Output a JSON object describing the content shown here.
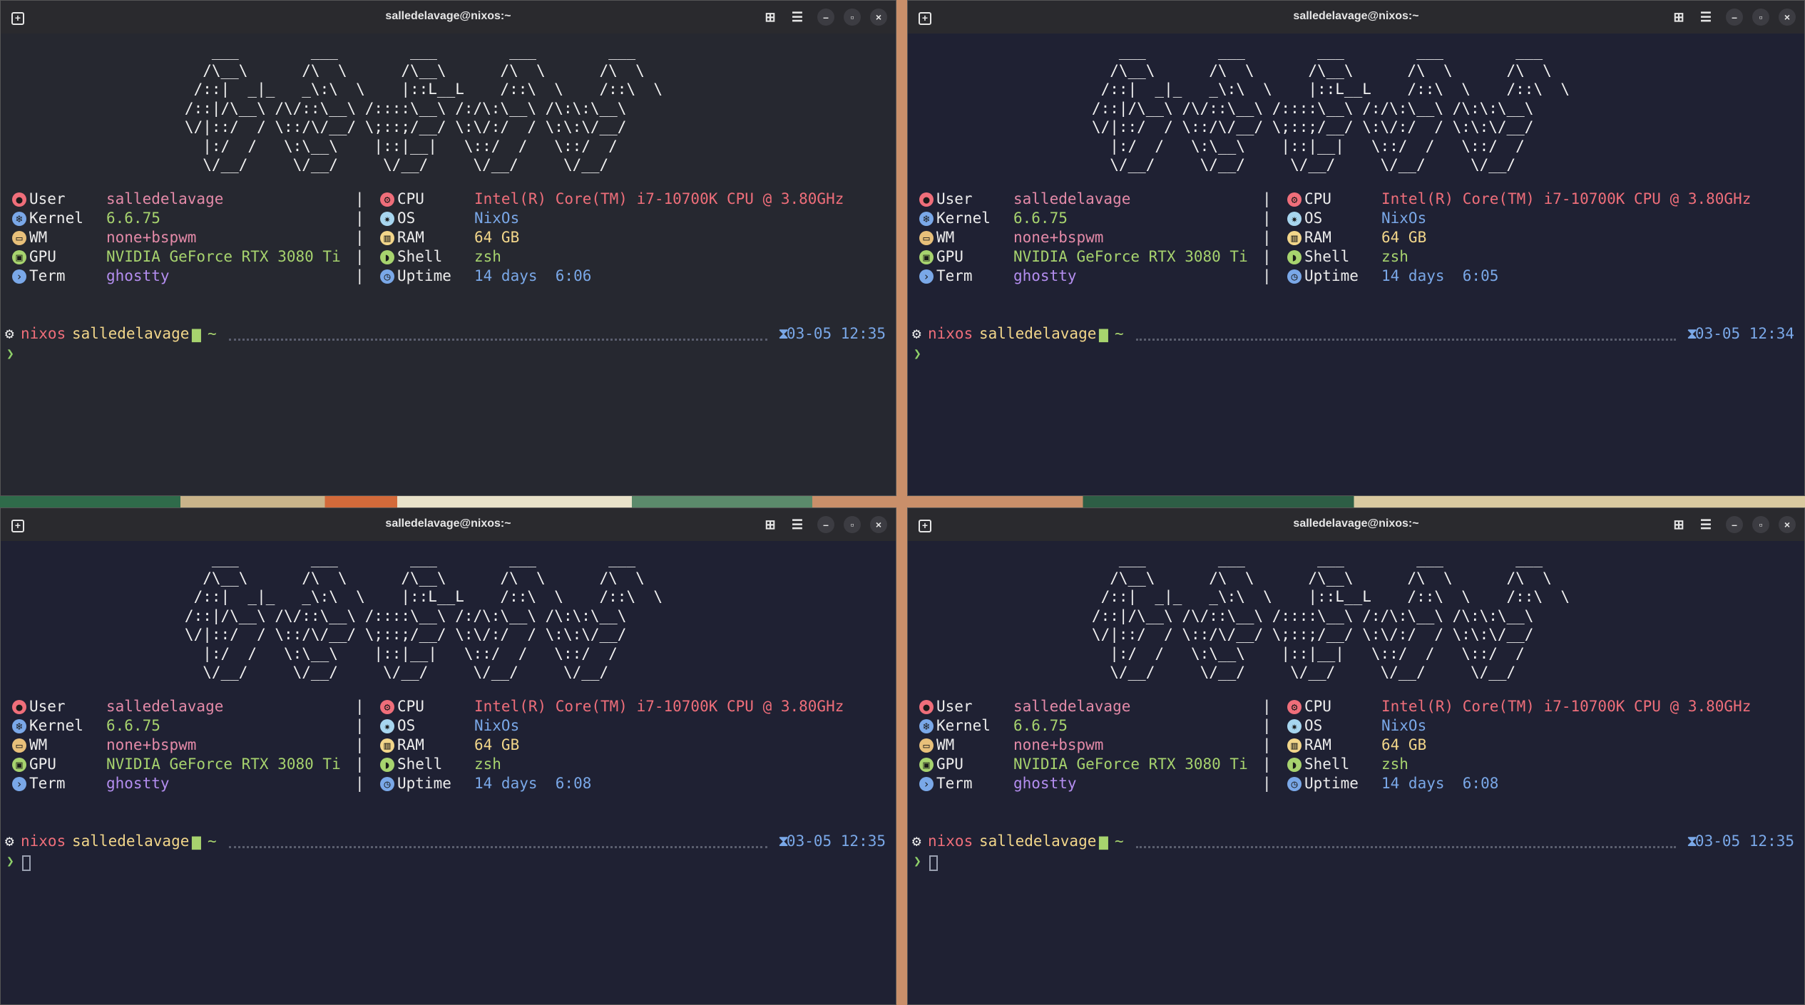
{
  "window_title": "salledelavage@nixos:~",
  "ascii_logo": "      ___        ___        ___        ___        ___     \n     /\\__\\      /\\  \\      /\\__\\      /\\  \\      /\\  \\    \n    /::|  _|_   _\\:\\  \\    |::L__L    /::\\  \\    /::\\  \\   \n   /::|/\\__\\ /\\/::\\__\\ /::::\\__\\ /:/\\:\\__\\ /\\:\\:\\__\\  \n   \\/|::/  / \\::/\\/__/ \\;::;/__/ \\:\\/:/  / \\:\\:\\/__/  \n     |:/  /   \\:\\__\\    |::|__|   \\::/  /   \\::/  /   \n     \\/__/     \\/__/     \\/__/     \\/__/     \\/__/    ",
  "separator": "|",
  "info_left": [
    {
      "icon": "user-circle-icon",
      "label": "User",
      "value": "salledelavage"
    },
    {
      "icon": "nix-flake-icon",
      "label": "Kernel",
      "value": "6.6.75"
    },
    {
      "icon": "window-manager-icon",
      "label": "WM",
      "value": "none+bspwm"
    },
    {
      "icon": "gpu-card-icon",
      "label": "GPU",
      "value": "NVIDIA GeForce RTX 3080 Ti"
    },
    {
      "icon": "terminal-prompt-icon",
      "label": "Term",
      "value": "ghostty"
    }
  ],
  "info_right": [
    {
      "icon": "cpu-chip-icon",
      "label": "CPU",
      "value": "Intel(R) Core(TM) i7-10700K CPU @ 3.80GHz"
    },
    {
      "icon": "gear-snowflake-icon",
      "label": "OS",
      "value": "NixOs"
    },
    {
      "icon": "ram-stick-icon",
      "label": "RAM",
      "value": "64 GB"
    },
    {
      "icon": "shell-icon",
      "label": "Shell",
      "value": "zsh"
    },
    {
      "icon": "clock-icon",
      "label": "Uptime",
      "value": ""
    }
  ],
  "prompt": {
    "host": "nixos",
    "user": "salledelavage",
    "dir": "~",
    "prompt_char": "❯"
  },
  "panes": [
    {
      "uptime": "14 days  6:06",
      "time": "03-05 12:35"
    },
    {
      "uptime": "14 days  6:05",
      "time": "03-05 12:34"
    },
    {
      "uptime": "14 days  6:08",
      "time": "03-05 12:35"
    },
    {
      "uptime": "14 days  6:08",
      "time": "03-05 12:35"
    }
  ],
  "colors": {
    "terminal_bg_dark": "#262830",
    "terminal_bg_navy": "#1f2133",
    "titlebar_bg": "#2a2a2e"
  }
}
